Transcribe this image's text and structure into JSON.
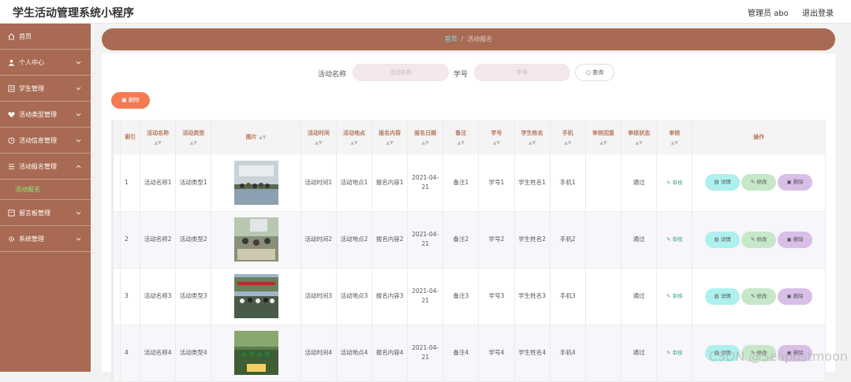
{
  "app_title": "学生活动管理系统小程序",
  "header": {
    "user": "管理员 abo",
    "logout": "退出登录"
  },
  "sidebar": {
    "items": [
      {
        "label": "首页",
        "icon": "home-icon"
      },
      {
        "label": "个人中心",
        "icon": "user-icon"
      },
      {
        "label": "学生管理",
        "icon": "list-icon"
      },
      {
        "label": "活动类型管理",
        "icon": "heart-icon"
      },
      {
        "label": "活动信息管理",
        "icon": "clock-icon"
      },
      {
        "label": "活动报名管理",
        "icon": "doc-icon"
      },
      {
        "label": "留言板管理",
        "icon": "note-icon"
      },
      {
        "label": "系统管理",
        "icon": "gear-icon"
      }
    ],
    "submenu_active": "活动报名"
  },
  "breadcrumb": {
    "home": "首页",
    "separator": "/",
    "current": "活动报名"
  },
  "search": {
    "name_label": "活动名称",
    "name_placeholder": "活动名称",
    "id_label": "学号",
    "id_placeholder": "学号",
    "query_button": "查询"
  },
  "toolbar": {
    "delete_label": "删除"
  },
  "table": {
    "columns": [
      "索引",
      "活动名称",
      "活动类型",
      "图片",
      "活动时间",
      "活动地点",
      "报名内容",
      "报名日期",
      "备注",
      "学号",
      "学生姓名",
      "手机",
      "审核回复",
      "审核状态",
      "审核",
      "操作"
    ],
    "rows": [
      {
        "index": "1",
        "name": "活动名称1",
        "type": "活动类型1",
        "time": "活动时间1",
        "place": "活动地点1",
        "content": "报名内容1",
        "date": "2021-04-21",
        "remark": "备注1",
        "student_id": "学号1",
        "student_name": "学生姓名1",
        "phone": "手机1",
        "reply": "",
        "status": "通过",
        "audit": "审核"
      },
      {
        "index": "2",
        "name": "活动名称2",
        "type": "活动类型2",
        "time": "活动时间2",
        "place": "活动地点2",
        "content": "报名内容2",
        "date": "2021-04-21",
        "remark": "备注2",
        "student_id": "学号2",
        "student_name": "学生姓名2",
        "phone": "手机2",
        "reply": "",
        "status": "通过",
        "audit": "审核"
      },
      {
        "index": "3",
        "name": "活动名称3",
        "type": "活动类型3",
        "time": "活动时间3",
        "place": "活动地点3",
        "content": "报名内容3",
        "date": "2021-04-21",
        "remark": "备注3",
        "student_id": "学号3",
        "student_name": "学生姓名3",
        "phone": "手机3",
        "reply": "",
        "status": "通过",
        "audit": "审核"
      },
      {
        "index": "4",
        "name": "活动名称4",
        "type": "活动类型4",
        "time": "活动时间4",
        "place": "活动地点4",
        "content": "报名内容4",
        "date": "2021-04-21",
        "remark": "备注4",
        "student_id": "学号4",
        "student_name": "学生姓名4",
        "phone": "手机4",
        "reply": "",
        "status": "通过",
        "audit": "审核"
      }
    ],
    "actions": {
      "detail": "详情",
      "edit": "修改",
      "delete": "删除"
    }
  },
  "watermark": "CSDN @Seapostmoon",
  "colors": {
    "sidebar": "#a86a52",
    "accent_orange": "#f47a52",
    "active_sub": "#8bf07a",
    "detail_btn": "#aef0ed",
    "edit_btn": "#c6e8c9",
    "delete_btn": "#d9bfe8"
  }
}
